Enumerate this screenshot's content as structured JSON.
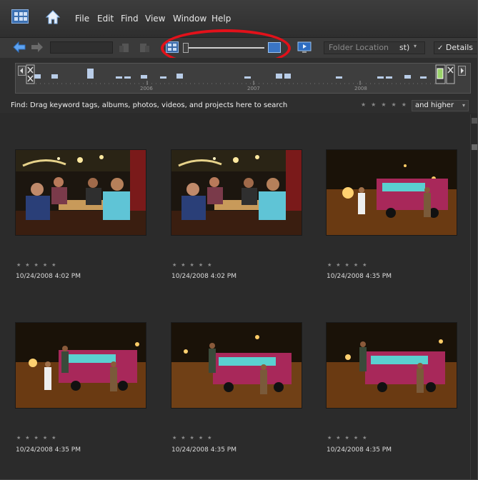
{
  "menubar": {
    "items": [
      "File",
      "Edit",
      "Find",
      "View",
      "Window",
      "Help"
    ]
  },
  "toolbar": {
    "folder_location_placeholder": "Folder Location",
    "sort_value": "st)",
    "details_label": "Details"
  },
  "timeline": {
    "years": [
      "2006",
      "2007",
      "2008"
    ]
  },
  "findbar": {
    "text": "Find: Drag keyword tags, albums, photos, videos, and projects here to search",
    "stars": "★★★★★",
    "rating_filter": "and higher"
  },
  "photos": [
    {
      "scene": "restaurant",
      "stars": "★★★★★",
      "date": "10/24/2008 4:02 PM"
    },
    {
      "scene": "restaurant",
      "stars": "★★★★★",
      "date": "10/24/2008 4:02 PM"
    },
    {
      "scene": "street",
      "stars": "★★★★★",
      "date": "10/24/2008 4:35 PM"
    },
    {
      "scene": "street",
      "stars": "★★★★★",
      "date": "10/24/2008 4:35 PM"
    },
    {
      "scene": "street",
      "stars": "★★★★★",
      "date": "10/24/2008 4:35 PM"
    },
    {
      "scene": "street",
      "stars": "★★★★★",
      "date": "10/24/2008 4:35 PM"
    }
  ],
  "colors": {
    "background": "#2b2b2b",
    "highlight_oval": "#e2111a",
    "accent_blue": "#4a90d9"
  }
}
